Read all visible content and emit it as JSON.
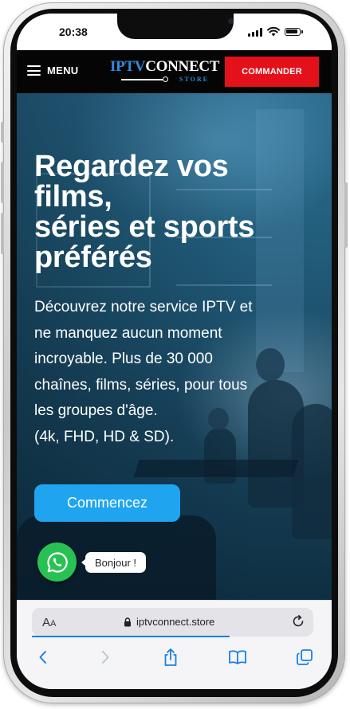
{
  "status_bar": {
    "time": "20:38"
  },
  "header": {
    "menu_label": "MENU",
    "logo_part1": "IPTV",
    "logo_part2": "CONNECT",
    "logo_sub": "STORE",
    "order_button": "COMMANDER"
  },
  "hero": {
    "title_lines": [
      "Regardez vos",
      "films,",
      "séries et sports",
      "préférés"
    ],
    "description_lines": [
      "Découvrez notre service IPTV et",
      "ne manquez aucun moment",
      "incroyable. Plus de 30 000",
      "chaînes, films, séries, pour tous",
      "les groupes d'âge.",
      "(4k, FHD, HD & SD)."
    ],
    "cta_label": "Commencez"
  },
  "whatsapp": {
    "bubble_text": "Bonjour !",
    "icon": "whatsapp-icon"
  },
  "browser": {
    "text_size_label_large": "A",
    "text_size_label_small": "A",
    "url": "iptvconnect.store",
    "nav_icons": [
      "back-icon",
      "forward-icon",
      "share-icon",
      "bookmarks-icon",
      "tabs-icon"
    ],
    "accent_color": "#1a7ee8"
  },
  "colors": {
    "order_button": "#e4101a",
    "cta_button": "#1fa4f0",
    "whatsapp": "#29c153",
    "header_bg": "#050505"
  }
}
